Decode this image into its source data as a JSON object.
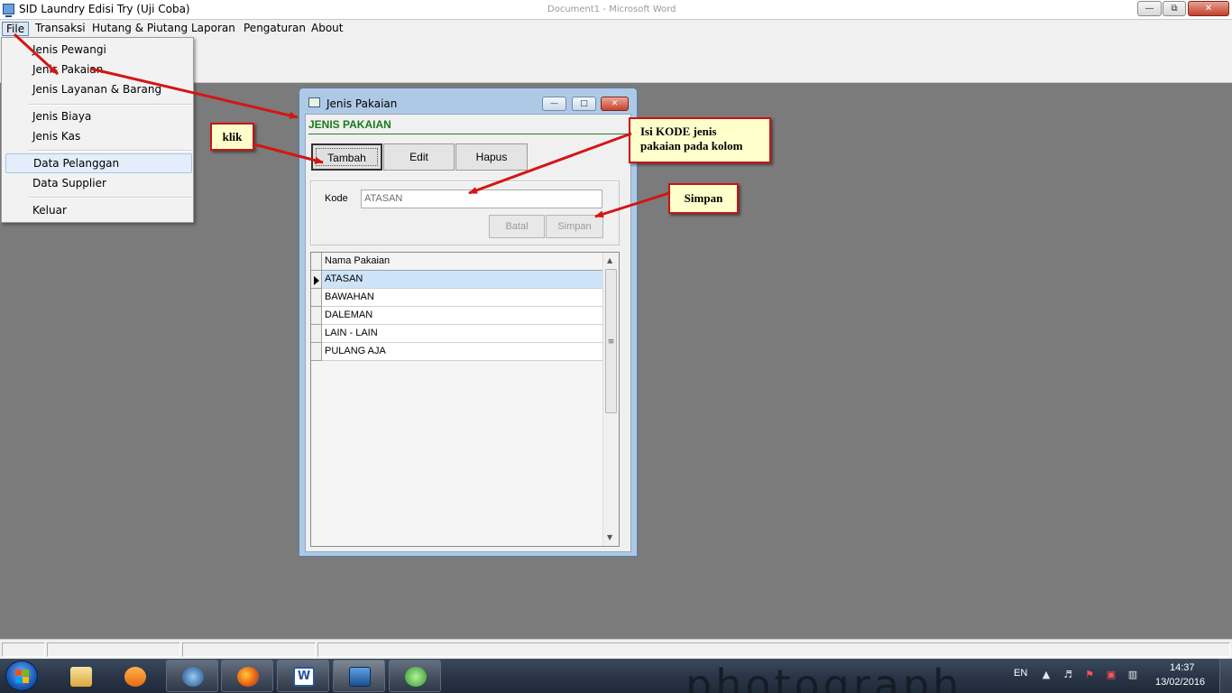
{
  "app": {
    "title": "SID Laundry Edisi Try (Uji Coba)",
    "background_window_title": "Document1 - Microsoft Word"
  },
  "menubar": {
    "items": [
      "File",
      "Transaksi",
      "Hutang & Piutang",
      "Laporan",
      "Pengaturan",
      "About"
    ]
  },
  "file_menu": {
    "items": [
      "Jenis Pewangi",
      "Jenis Pakaian",
      "Jenis Layanan & Barang",
      "Jenis Biaya",
      "Jenis Kas",
      "Data Pelanggan",
      "Data Supplier",
      "Keluar"
    ],
    "highlighted": "Data Pelanggan"
  },
  "child_window": {
    "title": "Jenis Pakaian",
    "form_heading": "JENIS PAKAIAN",
    "buttons": {
      "add": "Tambah",
      "edit": "Edit",
      "delete": "Hapus",
      "cancel": "Batal",
      "save": "Simpan"
    },
    "kode_label": "Kode",
    "kode_value": "ATASAN",
    "grid": {
      "header": "Nama Pakaian",
      "rows": [
        "ATASAN",
        "BAWAHAN",
        "DALEMAN",
        "LAIN - LAIN",
        "PULANG AJA"
      ],
      "current_row": 0
    }
  },
  "annotations": {
    "klik": "klik",
    "isi_kode_line1": "Isi KODE jenis",
    "isi_kode_line2": "pakaian pada kolom",
    "simpan": "Simpan",
    "arrow_color": "#d41515"
  },
  "taskbar": {
    "language": "EN",
    "time": "14:37",
    "date": "13/02/2016",
    "apps": [
      "file-explorer",
      "media-player",
      "media-center",
      "firefox",
      "word",
      "laundry-app",
      "green-app"
    ],
    "wallpaper_text": "photograph"
  }
}
